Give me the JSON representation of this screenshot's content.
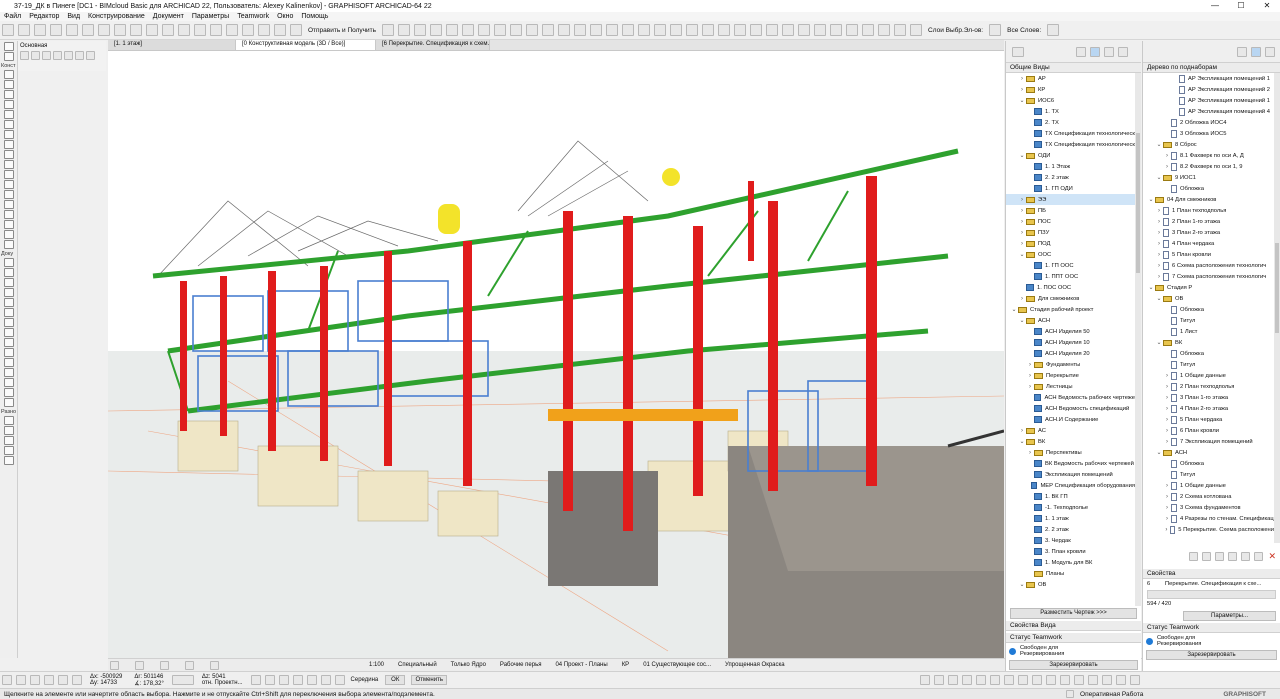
{
  "app": {
    "title": "37-19_ДК в Пинеге [DC1 - BIMcloud Basic для ARCHICAD 22, Пользователь: Alexey Kalinenkov] - GRAPHISOFT ARCHICAD-64 22",
    "menu": [
      "Файл",
      "Редактор",
      "Вид",
      "Конструирование",
      "Документ",
      "Параметры",
      "Teamwork",
      "Окно",
      "Помощь"
    ]
  },
  "toolbar": {
    "send_receive": "Отправить и Получить",
    "layers_label": "Слои Выбр.Эл-ов:",
    "all_layers": "Все Слоев:"
  },
  "toolbox": {
    "sections": [
      "Основная",
      "Конст",
      "Доку",
      "Разно"
    ]
  },
  "tabs": [
    "[1. 1 этаж]",
    "[0 Конструктивная модель (3D / Все)]",
    "[6 Перекрытие. Спецификация к схем..."
  ],
  "navigator_left": {
    "title": "Общие Виды",
    "items": [
      {
        "label": "АР",
        "type": "folder",
        "level": 1,
        "chev": ">"
      },
      {
        "label": "КР",
        "type": "folder",
        "level": 1,
        "chev": ">"
      },
      {
        "label": "ИОС6",
        "type": "folder",
        "level": 1,
        "chev": "v"
      },
      {
        "label": "1. ТХ",
        "type": "view",
        "level": 2,
        "chev": ""
      },
      {
        "label": "2. ТХ",
        "type": "view",
        "level": 2,
        "chev": ""
      },
      {
        "label": "ТХ Спецификация технологическ",
        "type": "view",
        "level": 2,
        "chev": ""
      },
      {
        "label": "ТХ Спецификация технологическ",
        "type": "view",
        "level": 2,
        "chev": ""
      },
      {
        "label": "ОДИ",
        "type": "folder",
        "level": 1,
        "chev": "v"
      },
      {
        "label": "1. 1 Этаж",
        "type": "view",
        "level": 2,
        "chev": ""
      },
      {
        "label": "2. 2 этаж",
        "type": "view",
        "level": 2,
        "chev": ""
      },
      {
        "label": "1. ГП ОДИ",
        "type": "view",
        "level": 2,
        "chev": ""
      },
      {
        "label": "ЭЭ",
        "type": "folder",
        "level": 1,
        "chev": ">",
        "selected": true
      },
      {
        "label": "ПБ",
        "type": "folder",
        "level": 1,
        "chev": ">"
      },
      {
        "label": "ПОС",
        "type": "folder",
        "level": 1,
        "chev": ">"
      },
      {
        "label": "ПЗУ",
        "type": "folder",
        "level": 1,
        "chev": ">"
      },
      {
        "label": "ПОД",
        "type": "folder",
        "level": 1,
        "chev": ">"
      },
      {
        "label": "ООС",
        "type": "folder",
        "level": 1,
        "chev": "v"
      },
      {
        "label": "1. ГП ООС",
        "type": "view",
        "level": 2,
        "chev": ""
      },
      {
        "label": "1. ППТ ООС",
        "type": "view",
        "level": 2,
        "chev": ""
      },
      {
        "label": "1. ПОС ООС",
        "type": "view",
        "level": 1,
        "chev": ""
      },
      {
        "label": "Для смежников",
        "type": "folder",
        "level": 1,
        "chev": ">"
      },
      {
        "label": "Стадия рабочий проект",
        "type": "folder",
        "level": 0,
        "chev": "v"
      },
      {
        "label": "АСН",
        "type": "folder",
        "level": 1,
        "chev": "v"
      },
      {
        "label": "АСН Изделия 50",
        "type": "view",
        "level": 2,
        "chev": ""
      },
      {
        "label": "АСН Изделия 10",
        "type": "view",
        "level": 2,
        "chev": ""
      },
      {
        "label": "АСН Изделия 20",
        "type": "view",
        "level": 2,
        "chev": ""
      },
      {
        "label": "Фундаменты",
        "type": "folder",
        "level": 2,
        "chev": ">"
      },
      {
        "label": "Перекрытие",
        "type": "folder",
        "level": 2,
        "chev": ">"
      },
      {
        "label": "Лестницы",
        "type": "folder",
        "level": 2,
        "chev": ">"
      },
      {
        "label": "АСН Ведомость рабочих чертеже",
        "type": "view",
        "level": 2,
        "chev": ""
      },
      {
        "label": "АСН Ведомость спецификаций",
        "type": "view",
        "level": 2,
        "chev": ""
      },
      {
        "label": "АСН.И Содержание",
        "type": "view",
        "level": 2,
        "chev": ""
      },
      {
        "label": "АС",
        "type": "folder",
        "level": 1,
        "chev": ">"
      },
      {
        "label": "ВК",
        "type": "folder",
        "level": 1,
        "chev": "v"
      },
      {
        "label": "Перспективы",
        "type": "folder",
        "level": 2,
        "chev": ">"
      },
      {
        "label": "ВК Ведомость рабочих чертежей",
        "type": "view",
        "level": 2,
        "chev": ""
      },
      {
        "label": "Экспликация помещений",
        "type": "view",
        "level": 2,
        "chev": ""
      },
      {
        "label": "МЕР Спецификация оборудования",
        "type": "view",
        "level": 2,
        "chev": ""
      },
      {
        "label": "1. ВК ГП",
        "type": "view",
        "level": 2,
        "chev": ""
      },
      {
        "label": "-1. Техподполье",
        "type": "view",
        "level": 2,
        "chev": ""
      },
      {
        "label": "1. 1 этаж",
        "type": "view",
        "level": 2,
        "chev": ""
      },
      {
        "label": "2. 2 этаж",
        "type": "view",
        "level": 2,
        "chev": ""
      },
      {
        "label": "3. Чердак",
        "type": "view",
        "level": 2,
        "chev": ""
      },
      {
        "label": "3. План кровли",
        "type": "view",
        "level": 2,
        "chev": ""
      },
      {
        "label": "1. Модуль для ВК",
        "type": "view",
        "level": 2,
        "chev": ""
      },
      {
        "label": "Планы",
        "type": "folder",
        "level": 2,
        "chev": ""
      },
      {
        "label": "ОВ",
        "type": "folder",
        "level": 1,
        "chev": "v"
      }
    ],
    "button": "Разместить Чертеж >>>",
    "view_props": "Свойства Вида",
    "teamwork_title": "Статус Teamwork",
    "teamwork_status": "Свободен для Резервирования",
    "reserve_button": "Зарезервировать"
  },
  "navigator_right": {
    "title": "Дерево по поднаборам",
    "items": [
      {
        "label": "АР Экспликация помещений 1",
        "type": "sheet",
        "level": 3,
        "chev": ""
      },
      {
        "label": "АР Экспликация помещений 2",
        "type": "sheet",
        "level": 3,
        "chev": ""
      },
      {
        "label": "АР Экспликация помещений 1",
        "type": "sheet",
        "level": 3,
        "chev": ""
      },
      {
        "label": "АР Экспликация помещений 4",
        "type": "sheet",
        "level": 3,
        "chev": ""
      },
      {
        "label": "2 Обложка ИОС4",
        "type": "sheet",
        "level": 2,
        "chev": ""
      },
      {
        "label": "3 Обложка ИОС5",
        "type": "sheet",
        "level": 2,
        "chev": ""
      },
      {
        "label": "8 Сброс",
        "type": "folder",
        "level": 1,
        "chev": "v"
      },
      {
        "label": "8.1 Фахверк по оси А, Д",
        "type": "sheet",
        "level": 2,
        "chev": ">"
      },
      {
        "label": "8.2 Фахверк по оси 1, 9",
        "type": "sheet",
        "level": 2,
        "chev": ">"
      },
      {
        "label": "9 ИОС1",
        "type": "folder",
        "level": 1,
        "chev": "v"
      },
      {
        "label": "Обложка",
        "type": "sheet",
        "level": 2,
        "chev": ""
      },
      {
        "label": "04 Для смежников",
        "type": "folder",
        "level": 0,
        "chev": "v"
      },
      {
        "label": "1 План техподполья",
        "type": "sheet",
        "level": 1,
        "chev": ">"
      },
      {
        "label": "2 План 1-го этажа",
        "type": "sheet",
        "level": 1,
        "chev": ">"
      },
      {
        "label": "3 План 2-го этажа",
        "type": "sheet",
        "level": 1,
        "chev": ">"
      },
      {
        "label": "4 План чердака",
        "type": "sheet",
        "level": 1,
        "chev": ">"
      },
      {
        "label": "5 План кровли",
        "type": "sheet",
        "level": 1,
        "chev": ">"
      },
      {
        "label": "6 Схема расположения технологич",
        "type": "sheet",
        "level": 1,
        "chev": ">"
      },
      {
        "label": "7 Схема расположения технологич",
        "type": "sheet",
        "level": 1,
        "chev": ">"
      },
      {
        "label": "Стадия Р",
        "type": "folder",
        "level": 0,
        "chev": "v"
      },
      {
        "label": "ОВ",
        "type": "folder",
        "level": 1,
        "chev": "v"
      },
      {
        "label": "Обложка",
        "type": "sheet",
        "level": 2,
        "chev": ""
      },
      {
        "label": "Титул",
        "type": "sheet",
        "level": 2,
        "chev": ""
      },
      {
        "label": "1 Лист",
        "type": "sheet",
        "level": 2,
        "chev": ""
      },
      {
        "label": "ВК",
        "type": "folder",
        "level": 1,
        "chev": "v"
      },
      {
        "label": "Обложка",
        "type": "sheet",
        "level": 2,
        "chev": ""
      },
      {
        "label": "Титул",
        "type": "sheet",
        "level": 2,
        "chev": ""
      },
      {
        "label": "1 Общие данные",
        "type": "sheet",
        "level": 2,
        "chev": ">"
      },
      {
        "label": "2 План техподполья",
        "type": "sheet",
        "level": 2,
        "chev": ">"
      },
      {
        "label": "3 План 1-го этажа",
        "type": "sheet",
        "level": 2,
        "chev": ">"
      },
      {
        "label": "4 План 2-го этажа",
        "type": "sheet",
        "level": 2,
        "chev": ">"
      },
      {
        "label": "5 План чердака",
        "type": "sheet",
        "level": 2,
        "chev": ">"
      },
      {
        "label": "6 План кровли",
        "type": "sheet",
        "level": 2,
        "chev": ">"
      },
      {
        "label": "7 Экспликация помещений",
        "type": "sheet",
        "level": 2,
        "chev": ">"
      },
      {
        "label": "АСН",
        "type": "folder",
        "level": 1,
        "chev": "v"
      },
      {
        "label": "Обложка",
        "type": "sheet",
        "level": 2,
        "chev": ""
      },
      {
        "label": "Титул",
        "type": "sheet",
        "level": 2,
        "chev": ""
      },
      {
        "label": "1 Общие данные",
        "type": "sheet",
        "level": 2,
        "chev": ">"
      },
      {
        "label": "2 Схема котлована",
        "type": "sheet",
        "level": 2,
        "chev": ">"
      },
      {
        "label": "3 Схема фундаментов",
        "type": "sheet",
        "level": 2,
        "chev": ">"
      },
      {
        "label": "4 Разрезы по стенам. Спецификац",
        "type": "sheet",
        "level": 2,
        "chev": ">"
      },
      {
        "label": "5 Перекрытие. Схема расположени",
        "type": "sheet",
        "level": 2,
        "chev": ">"
      }
    ],
    "props_title": "Свойства",
    "props_num": "6",
    "props_name": "Перекрытие. Спецификация к схе...",
    "props_size": "594 / 420",
    "params_button": "Параметры...",
    "teamwork_title": "Статус Teamwork",
    "teamwork_status": "Свободен для Резервирования",
    "reserve_button": "Зарезервировать"
  },
  "statusbar": {
    "scale": "1:100",
    "special": "Специальный",
    "core_only": "Только Ядро",
    "pens": "Рабочие перья",
    "project": "04 Проект - Планы",
    "kr": "КР",
    "existing": "01 Существующее сос...",
    "simplified": "Упрощенная Окраска"
  },
  "coords": {
    "dx": "Δx: -500929",
    "dy": "Δy: 14733",
    "dr": "Δr: 501146",
    "angle": "∡: 178,32°",
    "dz": "Δz: 5041",
    "rel": "отн. Проектн...",
    "center": "Середина",
    "ok": "ОК",
    "cancel": "Отменить"
  },
  "hint": "Щелкните на элементе или начертите область выбора. Нажмите и не отпускайте Ctrl+Shift для переключения выбора элемента/подэлемента.",
  "bottom_right": {
    "status": "Оперативная Работа",
    "brand": "GRAPHISOFT"
  }
}
